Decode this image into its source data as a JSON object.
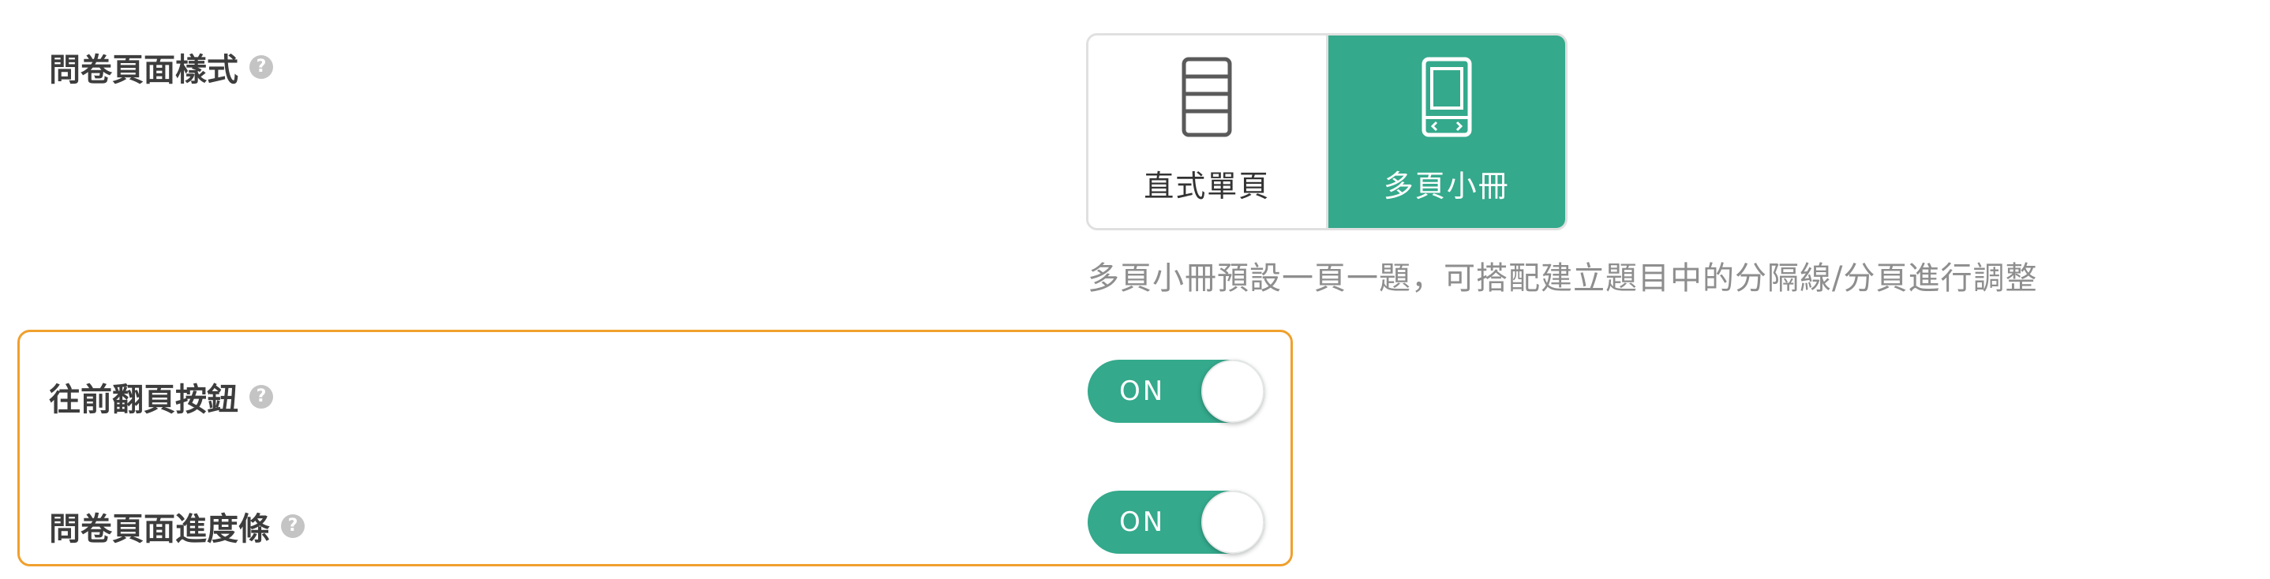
{
  "survey_style": {
    "label": "問卷頁面樣式",
    "help_icon": "question-circle-icon",
    "options": [
      {
        "label": "直式單頁",
        "icon": "single-page-icon",
        "selected": false
      },
      {
        "label": "多頁小冊",
        "icon": "booklet-icon",
        "selected": true
      }
    ],
    "hint": "多頁小冊預設一頁一題，可搭配建立題目中的分隔線/分頁進行調整"
  },
  "back_button": {
    "label": "往前翻頁按鈕",
    "help_icon": "question-circle-icon",
    "toggle_text": "ON",
    "enabled": true
  },
  "progress_bar": {
    "label": "問卷頁面進度條",
    "help_icon": "question-circle-icon",
    "toggle_text": "ON",
    "enabled": true
  },
  "colors": {
    "accent": "#34a98c",
    "highlight_border": "#f0a02d",
    "label_text": "#3d3d3d",
    "hint_text": "#8e8e8e",
    "help_icon": "#c4c4c4"
  }
}
